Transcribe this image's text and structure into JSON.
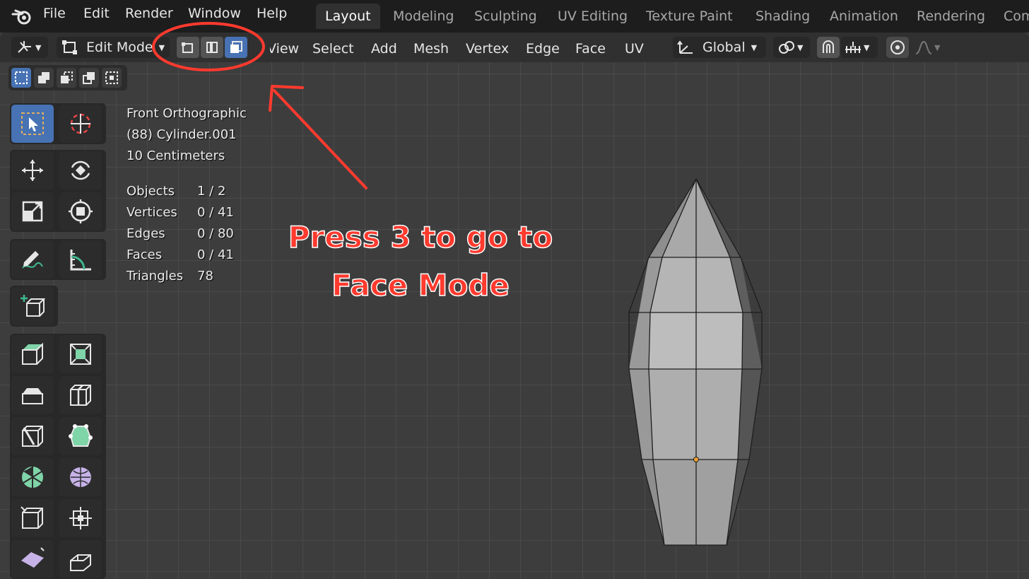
{
  "topbar": {
    "menus": [
      "File",
      "Edit",
      "Render",
      "Window",
      "Help"
    ],
    "workspace_tabs": [
      "Layout",
      "Modeling",
      "Sculpting",
      "UV Editing",
      "Texture Paint",
      "Shading",
      "Animation",
      "Rendering",
      "Com"
    ],
    "active_tab": "Layout"
  },
  "header": {
    "mode": "Edit Mode",
    "select_modes": [
      "vertex-select-icon",
      "edge-select-icon",
      "face-select-icon"
    ],
    "active_select_mode": "face",
    "menus": [
      "View",
      "Select",
      "Add",
      "Mesh",
      "Vertex",
      "Edge",
      "Face",
      "UV"
    ],
    "transform_orientation": "Global"
  },
  "overlay": {
    "view_name": "Front Orthographic",
    "object_name": "(88) Cylinder.001",
    "scale": "10 Centimeters",
    "stats": [
      {
        "label": "Objects",
        "value": "1 / 2"
      },
      {
        "label": "Vertices",
        "value": "0 / 41"
      },
      {
        "label": "Edges",
        "value": "0 / 80"
      },
      {
        "label": "Faces",
        "value": "0 / 41"
      },
      {
        "label": "Triangles",
        "value": "78"
      }
    ]
  },
  "annotation": {
    "line1": "Press 3 to go to",
    "line2": "Face Mode",
    "color": "#ff3a2e"
  },
  "toolbar": {
    "tools": [
      "select-box-icon",
      "cursor-icon",
      "move-icon",
      "rotate-icon",
      "scale-icon",
      "transform-icon",
      "annotate-icon",
      "measure-icon",
      "add-cube-icon",
      "extrude-region-icon",
      "inset-faces-icon",
      "bevel-icon",
      "loop-cut-icon",
      "knife-icon",
      "poly-build-icon",
      "spin-icon",
      "smooth-icon",
      "edge-slide-icon",
      "shrink-fatten-icon",
      "shear-icon",
      "rip-icon"
    ]
  },
  "colors": {
    "accent": "#4772b3",
    "background": "#3d3d3d"
  }
}
